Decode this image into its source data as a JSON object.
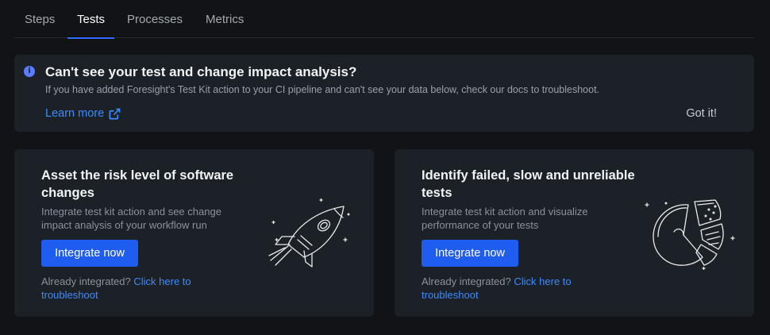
{
  "tabs": [
    {
      "label": "Steps",
      "active": false
    },
    {
      "label": "Tests",
      "active": true
    },
    {
      "label": "Processes",
      "active": false
    },
    {
      "label": "Metrics",
      "active": false
    }
  ],
  "banner": {
    "title": "Can't see your test and change impact analysis?",
    "description": "If you have added Foresight's Test Kit action to your CI pipeline and can't see your data below, check our docs to troubleshoot.",
    "learn_more": "Learn more",
    "dismiss": "Got it!"
  },
  "cards": [
    {
      "title": "Asset the risk level of software changes",
      "description": "Integrate test kit action and see change impact analysis of your workflow run",
      "button": "Integrate now",
      "already_text": "Already integrated?",
      "link": "Click here to troubleshoot",
      "illustration": "rocket-illustration"
    },
    {
      "title": "Identify failed, slow and unreliable tests",
      "description": "Integrate test kit action and visualize performance of your tests",
      "button": "Integrate now",
      "already_text": "Already integrated?",
      "link": "Click here to troubleshoot",
      "illustration": "pie-chart-illustration"
    }
  ],
  "colors": {
    "background": "#111316",
    "panel": "#1c2027",
    "accent": "#1f5cf0",
    "link": "#3b8cff"
  },
  "icons": {
    "info": "info-icon",
    "external_link": "external-link-icon"
  }
}
